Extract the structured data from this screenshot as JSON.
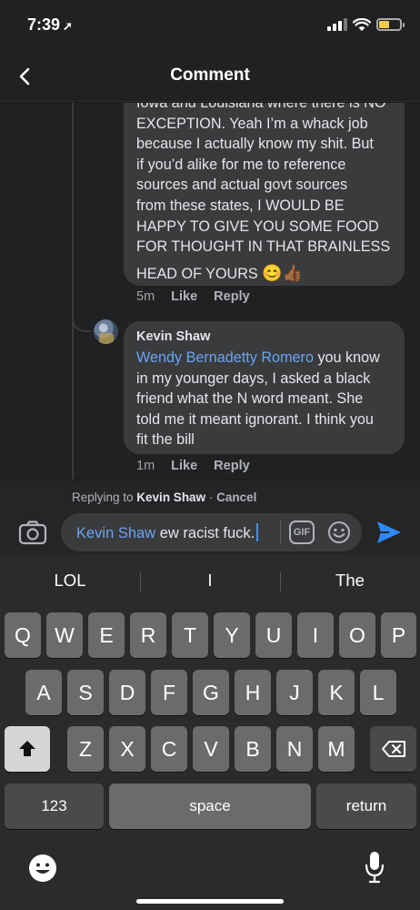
{
  "status": {
    "time": "7:39",
    "location_glyph": "➚"
  },
  "header": {
    "title": "Comment",
    "back_icon": "chevron-left-icon"
  },
  "comments": [
    {
      "lines": [
        "Iowa and Louisiana where there is NO",
        "EXCEPTION. Yeah I’m a whack job",
        "because I actually know my shit. But",
        "if you’d alike for me to reference",
        "sources and actual govt sources",
        "from these states, I WOULD BE",
        "HAPPY TO GIVE YOU SOME FOOD",
        "FOR THOUGHT IN THAT BRAINLESS",
        "HEAD OF YOURS"
      ],
      "emojis": "😊👍🏾",
      "time": "5m",
      "like": "Like",
      "reply": "Reply"
    },
    {
      "author": "Kevin Shaw",
      "mention": "Wendy Bernadetty Romero",
      "text_first": " you know",
      "lines": [
        "in my younger days, I asked a black",
        "friend what the N word meant. She",
        "told me it meant ignorant. I think you",
        "fit the bill"
      ],
      "time": "1m",
      "like": "Like",
      "reply": "Reply"
    }
  ],
  "replying": {
    "prefix": "Replying to ",
    "name": "Kevin Shaw",
    "sep": " · ",
    "cancel": "Cancel"
  },
  "composer": {
    "mention": "Kevin Shaw",
    "text": " ew racist fuck.",
    "gif_label": "GIF"
  },
  "keyboard": {
    "suggestions": [
      "LOL",
      "I",
      "The"
    ],
    "row1": [
      "Q",
      "W",
      "E",
      "R",
      "T",
      "Y",
      "U",
      "I",
      "O",
      "P"
    ],
    "row2": [
      "A",
      "S",
      "D",
      "F",
      "G",
      "H",
      "J",
      "K",
      "L"
    ],
    "row3": [
      "Z",
      "X",
      "C",
      "V",
      "B",
      "N",
      "M"
    ],
    "numbers_label": "123",
    "space_label": "space",
    "return_label": "return"
  }
}
